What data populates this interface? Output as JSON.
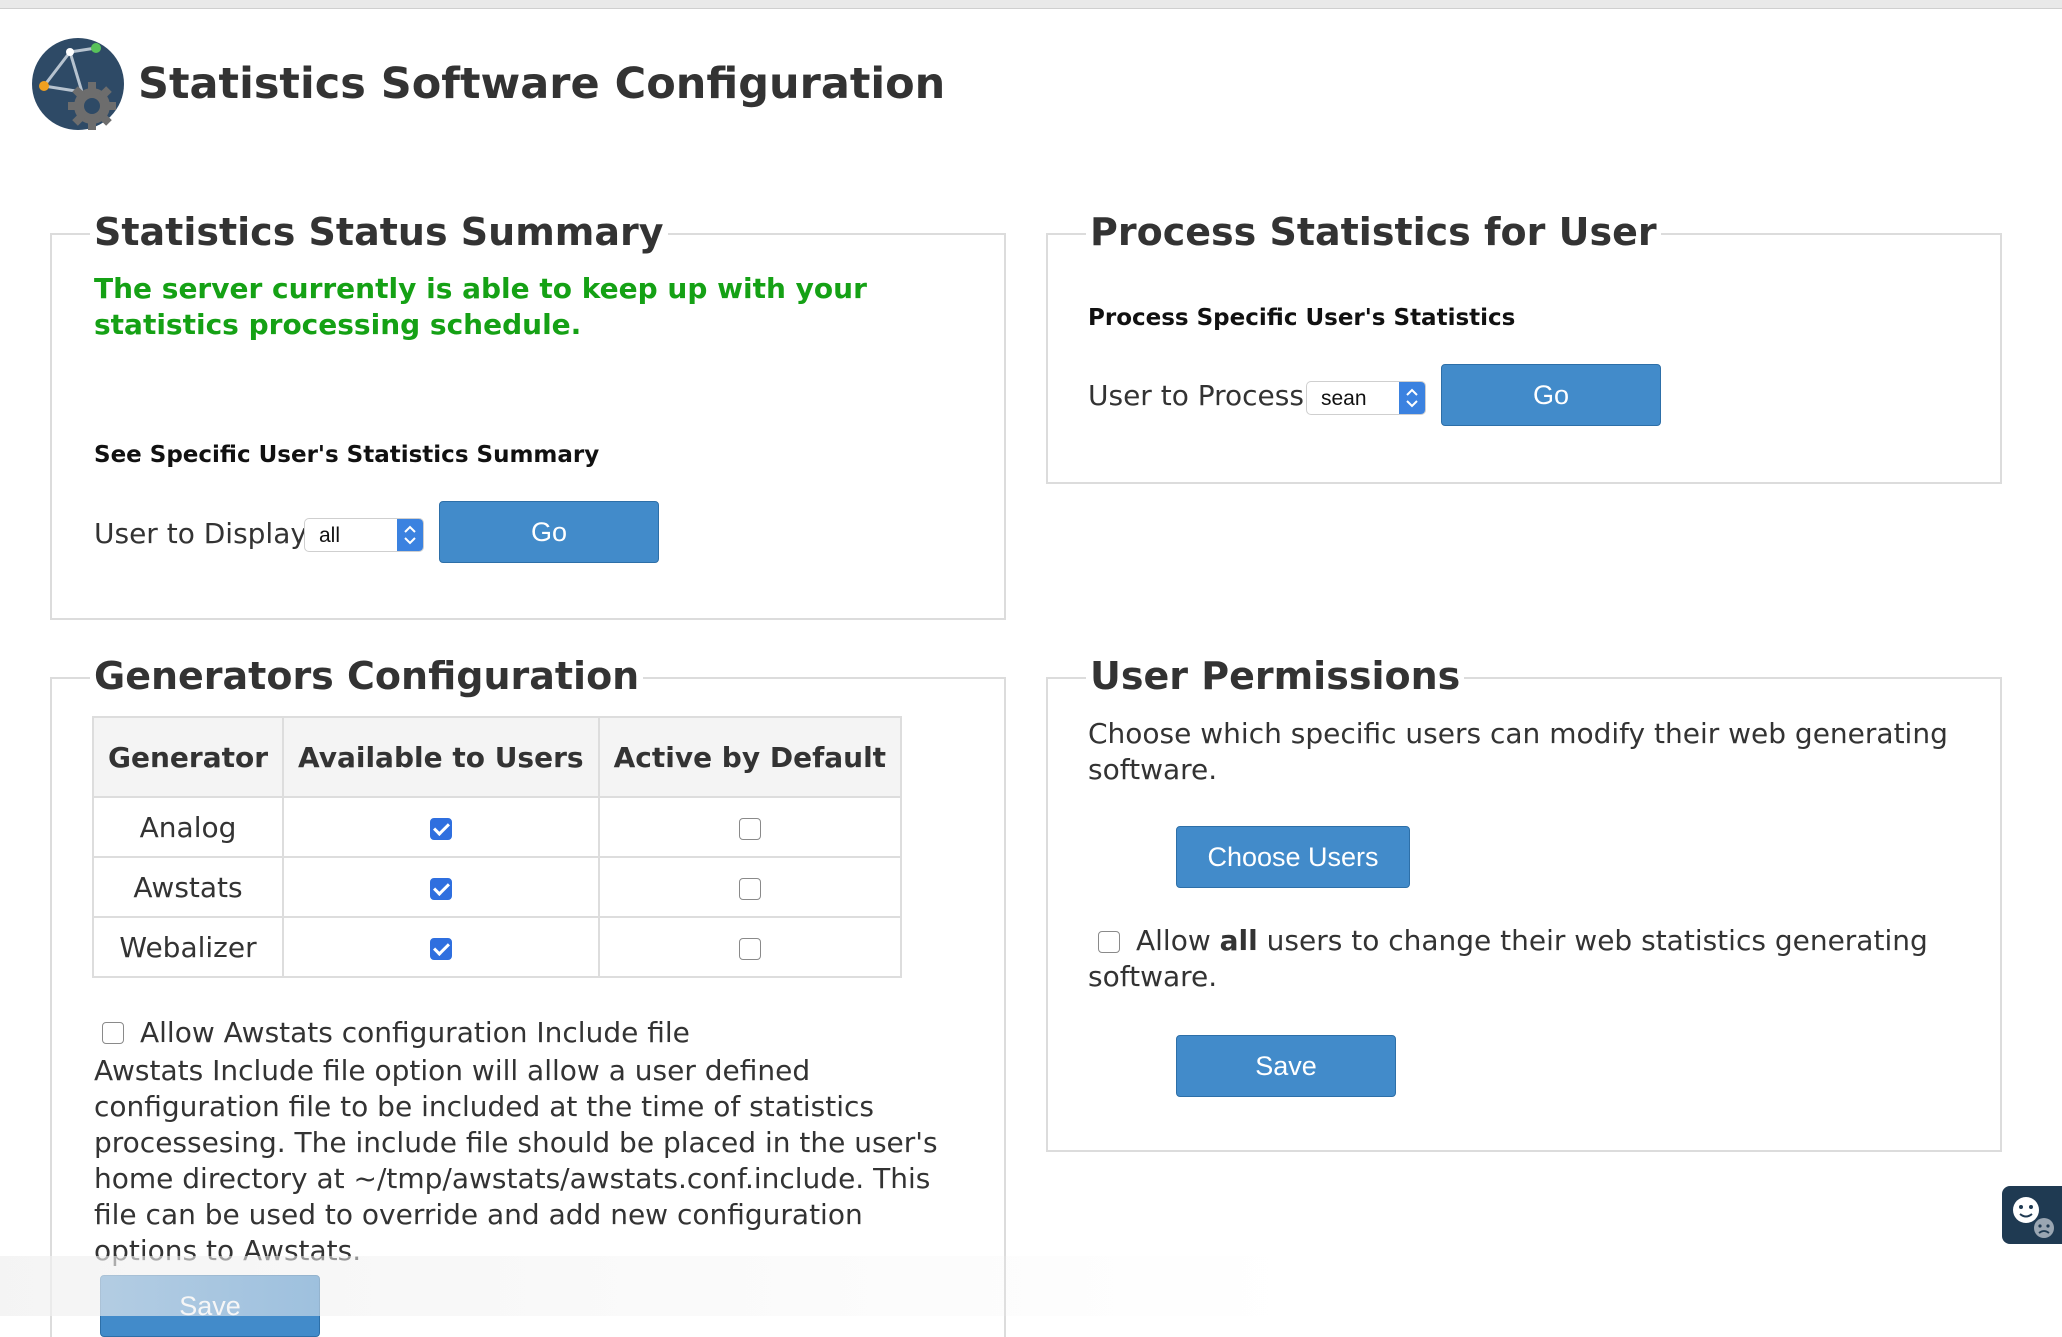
{
  "page": {
    "title": "Statistics Software Configuration"
  },
  "status_summary": {
    "legend": "Statistics Status Summary",
    "message": "The server currently is able to keep up with your statistics processing schedule.",
    "subheading": "See Specific User's Statistics Summary",
    "user_label": "User to Display:",
    "user_value": "all",
    "go_label": "Go"
  },
  "process_stats": {
    "legend": "Process Statistics for User",
    "subheading": "Process Specific User's Statistics",
    "user_label": "User to Process:",
    "user_value": "sean",
    "go_label": "Go"
  },
  "generators": {
    "legend": "Generators Configuration",
    "columns": [
      "Generator",
      "Available to Users",
      "Active by Default"
    ],
    "rows": [
      {
        "name": "Analog",
        "available": true,
        "active": false
      },
      {
        "name": "Awstats",
        "available": true,
        "active": false
      },
      {
        "name": "Webalizer",
        "available": true,
        "active": false
      }
    ],
    "include_checkbox_label": "Allow Awstats configuration Include file",
    "include_checked": false,
    "include_description": "Awstats Include file option will allow a user defined configuration file to be included at the time of statistics processesing. The include file should be placed in the user's home directory at ~/tmp/awstats/awstats.conf.include. This file can be used to override and add new configuration options to Awstats.",
    "save_label": "Save"
  },
  "user_permissions": {
    "legend": "User Permissions",
    "description": "Choose which specific users can modify their web generating software.",
    "choose_users_label": "Choose Users",
    "allow_all_prefix": "Allow ",
    "allow_all_bold": "all",
    "allow_all_suffix": " users to change their web statistics generating software.",
    "allow_all_checked": false,
    "save_label": "Save"
  },
  "colors": {
    "accent": "#428bca",
    "success_text": "#15a115",
    "checkbox_checked": "#2f6fdf"
  },
  "icons": {
    "logo": "statistics-gear-logo-icon",
    "select_arrows": "up-down-arrows-icon",
    "feedback": "feedback-faces-icon"
  }
}
